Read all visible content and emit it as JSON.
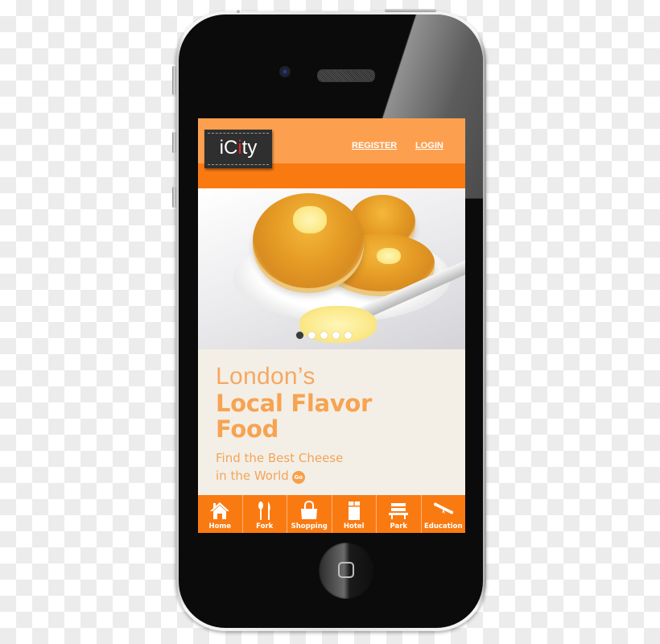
{
  "app": {
    "logo_prefix": "iC",
    "logo_booth": "i",
    "logo_suffix": "ty",
    "accent_color": "#fa7a12",
    "header_color": "#fca050"
  },
  "header": {
    "links": [
      {
        "label": "REGISTER"
      },
      {
        "label": "LOGIN"
      }
    ]
  },
  "hero": {
    "image_description": "Toasted crumpets with butter on a white plate with a butter knife",
    "slide_count": 5,
    "active_slide": 1
  },
  "content": {
    "headline_light": "London’s",
    "headline_bold_line1": "Local Flavor",
    "headline_bold_line2": "Food",
    "subtitle_line1": "Find the Best Cheese",
    "subtitle_line2": "in the World",
    "go_button_label": "Go"
  },
  "tabbar": {
    "items": [
      {
        "label": "Home",
        "icon": "home-icon"
      },
      {
        "label": "Fork",
        "icon": "fork-knife-icon"
      },
      {
        "label": "Shopping",
        "icon": "shopping-bag-icon"
      },
      {
        "label": "Hotel",
        "icon": "hotel-bed-icon"
      },
      {
        "label": "Park",
        "icon": "park-bench-icon"
      },
      {
        "label": "Education",
        "icon": "diploma-icon"
      }
    ]
  }
}
